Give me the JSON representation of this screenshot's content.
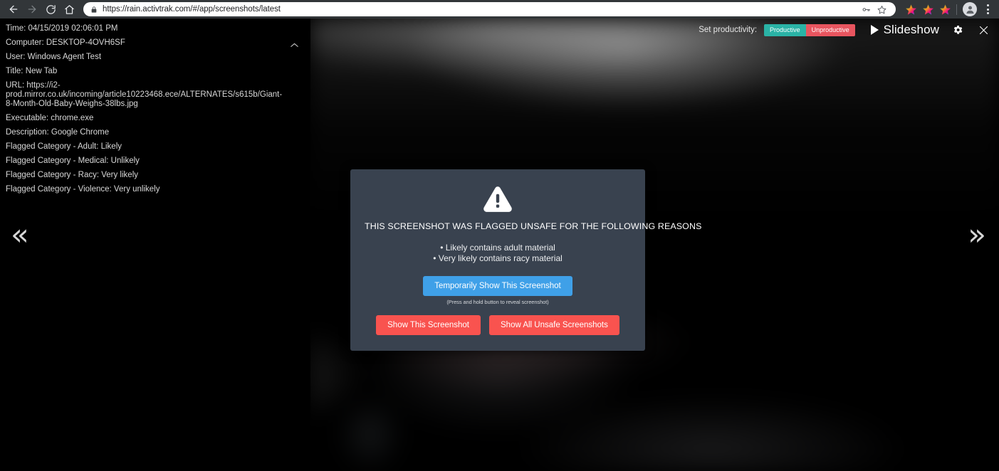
{
  "browser": {
    "back_label": "back-navigation",
    "forward_label": "forward-navigation",
    "reload_label": "reload-page",
    "home_label": "home-page",
    "url": "https://rain.activtrak.com/#/app/screenshots/latest",
    "lock_icon": "lock-icon",
    "key_icon": "password-key-icon",
    "bookmark_icon": "star-bookmark-icon",
    "extensions": [
      "extension-star-icon-1",
      "extension-star-icon-2",
      "extension-star-icon-3"
    ],
    "profile_icon": "profile-avatar-icon",
    "menu_icon": "three-dot-menu-icon"
  },
  "metadata": {
    "collapse_icon": "chevron-up-icon",
    "lines": [
      "Time: 04/15/2019 02:06:01 PM",
      "Computer: DESKTOP-4OVH6SF",
      "User: Windows Agent Test",
      "Title: New Tab",
      "URL: https://i2-prod.mirror.co.uk/incoming/article10223468.ece/ALTERNATES/s615b/Giant-8-Month-Old-Baby-Weighs-38lbs.jpg",
      "Executable: chrome.exe",
      "Description: Google Chrome",
      "Flagged Category - Adult: Likely",
      "Flagged Category - Medical: Unlikely",
      "Flagged Category - Racy: Very likely",
      "Flagged Category - Violence: Very unlikely"
    ]
  },
  "viewer_controls": {
    "set_productivity_label": "Set productivity:",
    "productive_label": "Productive",
    "unproductive_label": "Unproductive",
    "productive_color": "#2ab3a6",
    "unproductive_color": "#e8555f",
    "slideshow_label": "Slideshow",
    "play_icon": "play-triangle-icon",
    "settings_icon": "gear-icon",
    "close_icon": "close-x-icon"
  },
  "navigation": {
    "prev_icon": "double-chevron-left-icon",
    "prev_glyph": "«",
    "next_icon": "double-chevron-right-icon",
    "next_glyph": "»"
  },
  "unsafe_modal": {
    "warning_icon": "warning-triangle-icon",
    "heading": "THIS SCREENSHOT WAS FLAGGED UNSAFE FOR THE FOLLOWING REASONS",
    "reasons": [
      "• Likely contains adult material",
      "• Very likely contains racy material"
    ],
    "temporary_button": "Temporarily Show This Screenshot",
    "hint": "(Press and hold button to reveal screenshot)",
    "show_this_button": "Show This Screenshot",
    "show_all_button": "Show All Unsafe Screenshots",
    "accent_blue": "#3fa0e8",
    "accent_red": "#f9534f",
    "panel_color": "#39424f"
  }
}
